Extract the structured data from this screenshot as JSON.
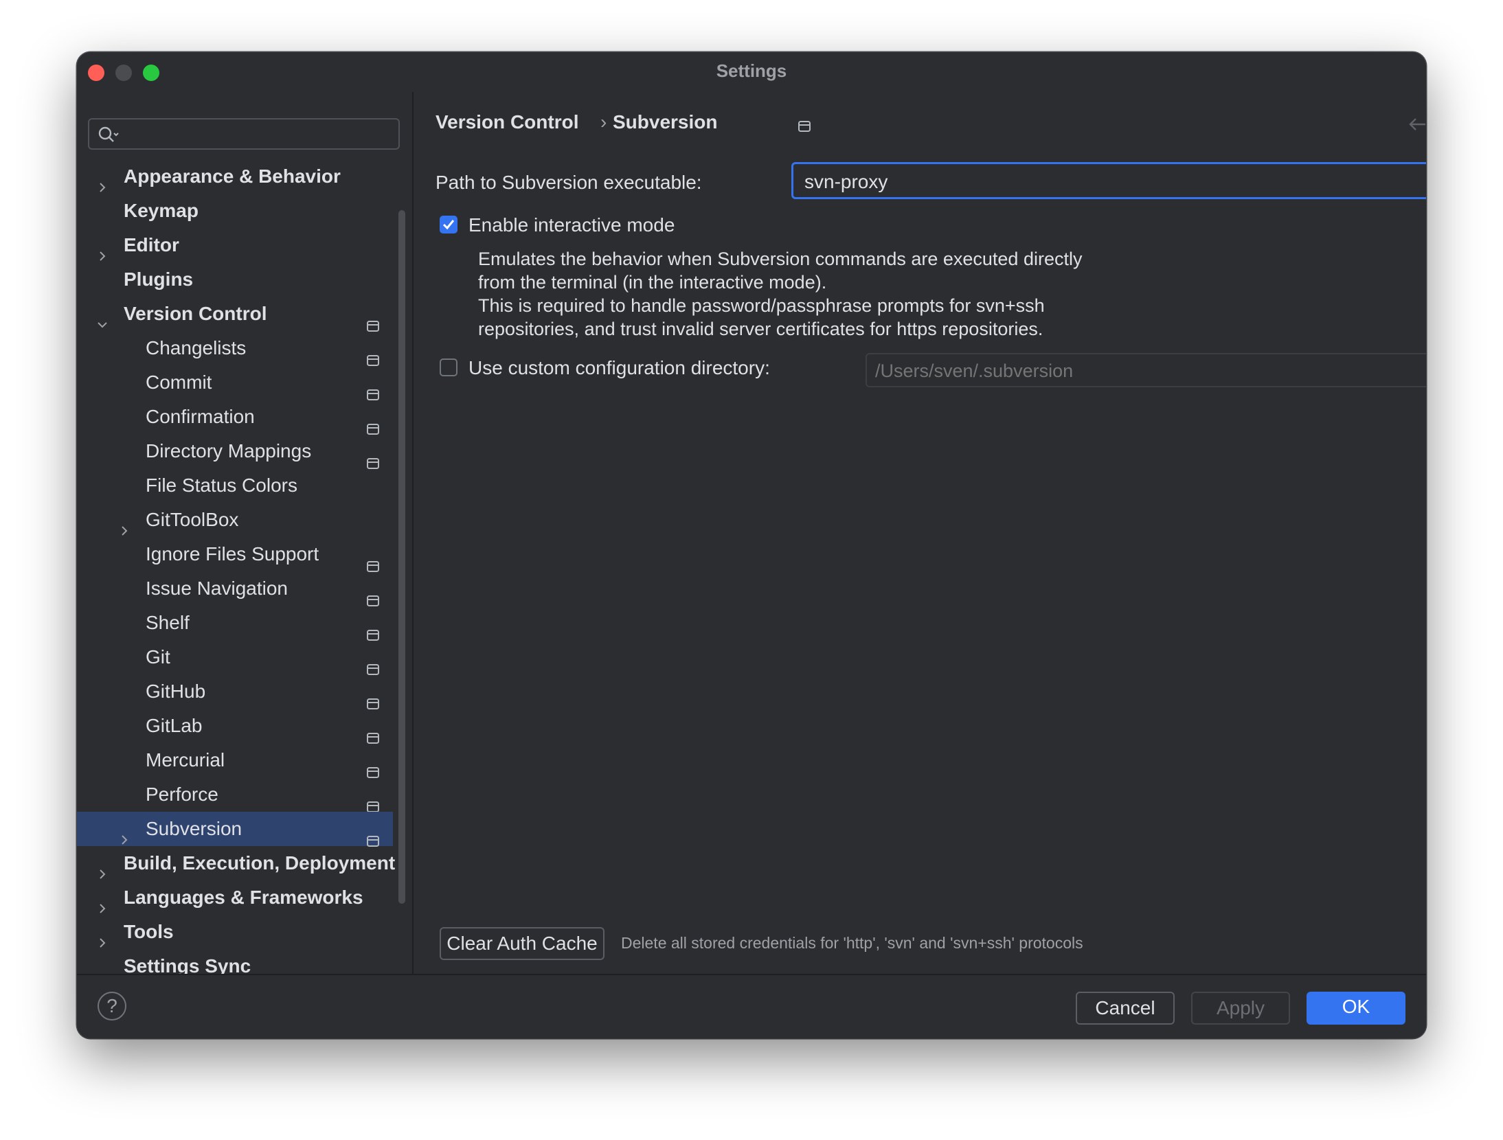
{
  "window": {
    "title": "Settings"
  },
  "sidebar": {
    "search_placeholder": "",
    "items": [
      {
        "label": "Appearance & Behavior",
        "bold": true,
        "level": 0,
        "chevron": "right",
        "project": false
      },
      {
        "label": "Keymap",
        "bold": true,
        "level": 0,
        "chevron": "none",
        "project": false
      },
      {
        "label": "Editor",
        "bold": true,
        "level": 0,
        "chevron": "right",
        "project": false
      },
      {
        "label": "Plugins",
        "bold": true,
        "level": 0,
        "chevron": "none",
        "project": false
      },
      {
        "label": "Version Control",
        "bold": true,
        "level": 0,
        "chevron": "down",
        "project": true
      },
      {
        "label": "Changelists",
        "bold": false,
        "level": 1,
        "chevron": "none",
        "project": true
      },
      {
        "label": "Commit",
        "bold": false,
        "level": 1,
        "chevron": "none",
        "project": true
      },
      {
        "label": "Confirmation",
        "bold": false,
        "level": 1,
        "chevron": "none",
        "project": true
      },
      {
        "label": "Directory Mappings",
        "bold": false,
        "level": 1,
        "chevron": "none",
        "project": true
      },
      {
        "label": "File Status Colors",
        "bold": false,
        "level": 1,
        "chevron": "none",
        "project": false
      },
      {
        "label": "GitToolBox",
        "bold": false,
        "level": 1,
        "chevron": "right",
        "project": false
      },
      {
        "label": "Ignore Files Support",
        "bold": false,
        "level": 1,
        "chevron": "none",
        "project": true
      },
      {
        "label": "Issue Navigation",
        "bold": false,
        "level": 1,
        "chevron": "none",
        "project": true
      },
      {
        "label": "Shelf",
        "bold": false,
        "level": 1,
        "chevron": "none",
        "project": true
      },
      {
        "label": "Git",
        "bold": false,
        "level": 1,
        "chevron": "none",
        "project": true
      },
      {
        "label": "GitHub",
        "bold": false,
        "level": 1,
        "chevron": "none",
        "project": true
      },
      {
        "label": "GitLab",
        "bold": false,
        "level": 1,
        "chevron": "none",
        "project": true
      },
      {
        "label": "Mercurial",
        "bold": false,
        "level": 1,
        "chevron": "none",
        "project": true
      },
      {
        "label": "Perforce",
        "bold": false,
        "level": 1,
        "chevron": "none",
        "project": true
      },
      {
        "label": "Subversion",
        "bold": false,
        "level": 1,
        "chevron": "right",
        "project": true,
        "selected": true
      },
      {
        "label": "Build, Execution, Deployment",
        "bold": true,
        "level": 0,
        "chevron": "right",
        "project": false
      },
      {
        "label": "Languages & Frameworks",
        "bold": true,
        "level": 0,
        "chevron": "right",
        "project": false
      },
      {
        "label": "Tools",
        "bold": true,
        "level": 0,
        "chevron": "right",
        "project": false
      },
      {
        "label": "Settings Sync",
        "bold": true,
        "level": 0,
        "chevron": "none",
        "project": false
      }
    ]
  },
  "main": {
    "breadcrumb": {
      "parent": "Version Control",
      "separator": "›",
      "current": "Subversion"
    },
    "path_label": "Path to Subversion executable:",
    "path_value": "svn-proxy",
    "interactive_label": "Enable interactive mode",
    "interactive_checked": true,
    "description_lines": [
      "Emulates the behavior when Subversion commands are executed directly",
      "from the terminal (in the interactive mode).",
      "This is required to handle password/passphrase prompts for svn+ssh",
      "repositories, and trust invalid server certificates for https repositories."
    ],
    "custom_dir_label": "Use custom configuration directory:",
    "custom_dir_checked": false,
    "custom_dir_placeholder": "/Users/sven/.subversion",
    "clear_button": "Clear Auth Cache",
    "clear_hint": "Delete all stored credentials for 'http', 'svn' and 'svn+ssh' protocols"
  },
  "footer": {
    "help": "?",
    "cancel": "Cancel",
    "apply": "Apply",
    "ok": "OK"
  },
  "colors": {
    "background": "#2b2d30",
    "accent": "#3574f0",
    "selection": "#2e436e",
    "text": "#dfe1e5"
  }
}
